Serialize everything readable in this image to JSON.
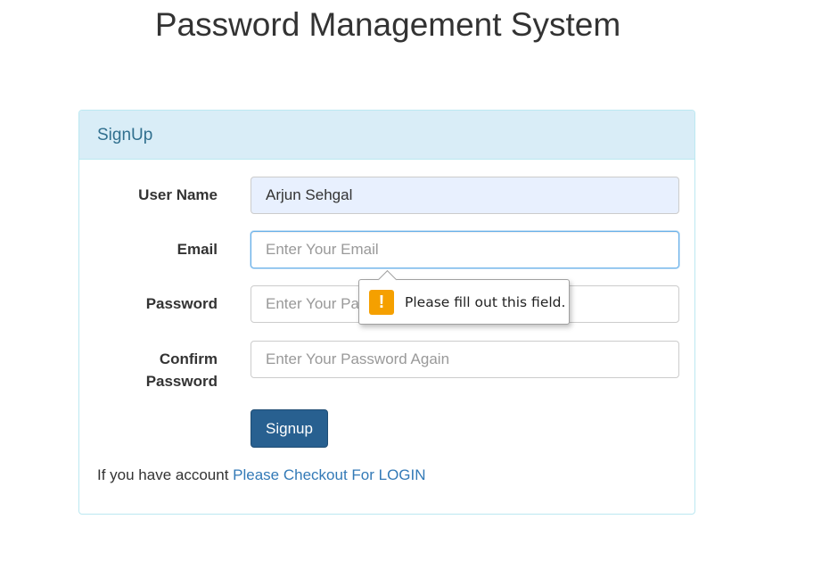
{
  "page": {
    "title": "Password Management System"
  },
  "panel": {
    "heading": "SignUp"
  },
  "form": {
    "username": {
      "label": "User Name",
      "value": "Arjun Sehgal",
      "placeholder": ""
    },
    "email": {
      "label": "Email",
      "value": "",
      "placeholder": "Enter Your Email"
    },
    "password": {
      "label": "Password",
      "value": "",
      "placeholder": "Enter Your Password"
    },
    "confirm_password": {
      "label_line1": "Confirm",
      "label_line2": "Password",
      "value": "",
      "placeholder": "Enter Your Password Again"
    },
    "submit_label": "Signup"
  },
  "footer": {
    "account_text": "If you have account ",
    "login_link": "Please Checkout For LOGIN"
  },
  "validation_tooltip": {
    "icon": "warning-icon",
    "message": "Please fill out this field."
  },
  "colors": {
    "heading_bg": "#d9edf7",
    "heading_text": "#31708f",
    "button_bg": "#286090",
    "link": "#337ab7",
    "warning": "#f5a000"
  }
}
